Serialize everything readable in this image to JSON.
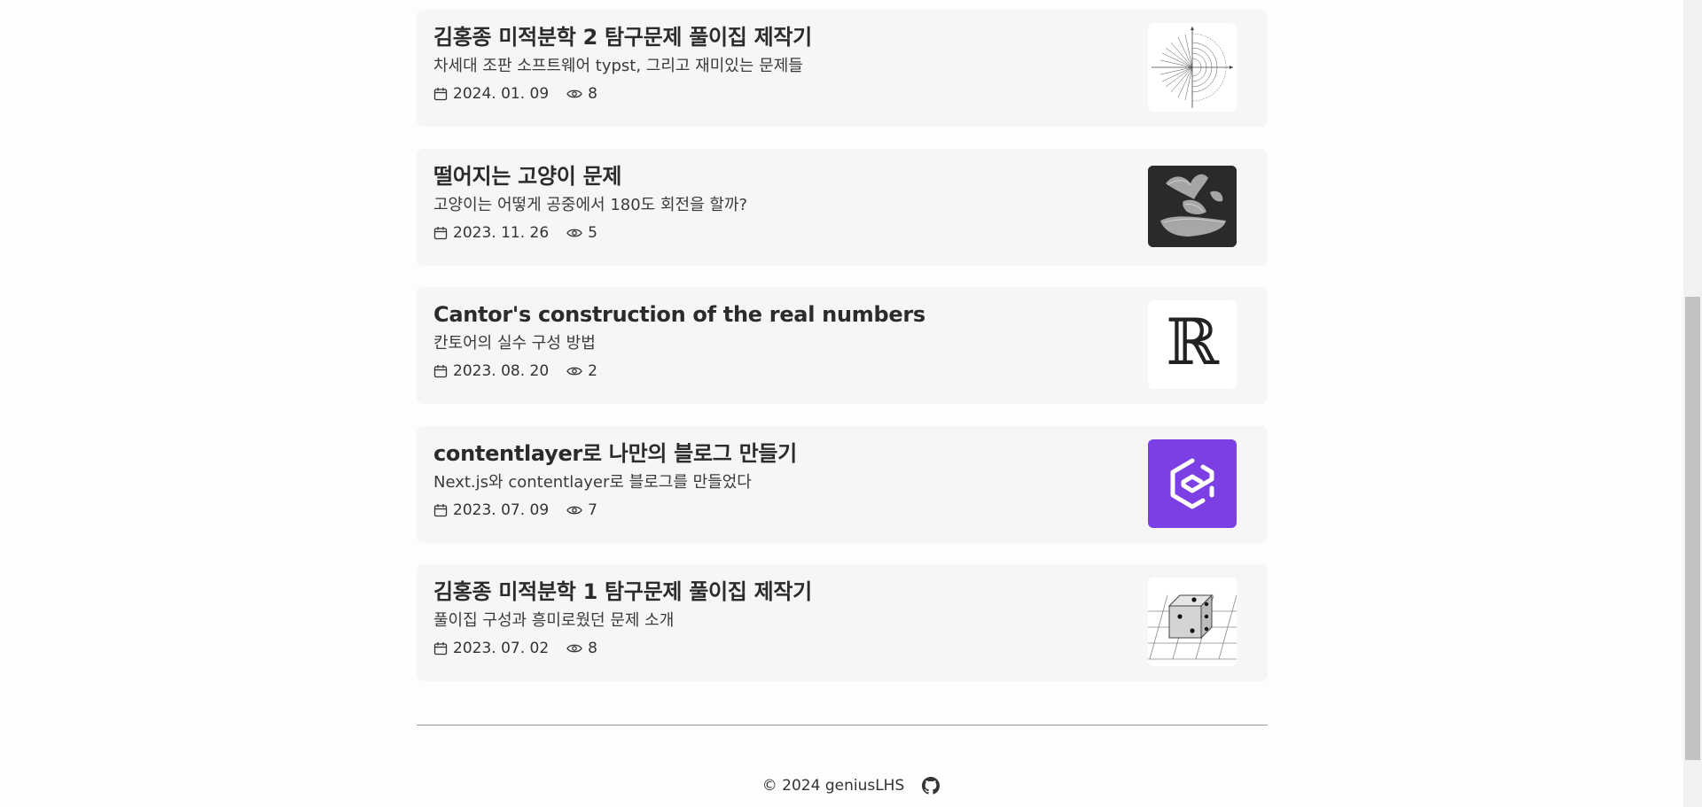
{
  "posts": [
    {
      "title": "김홍종 미적분학 2 탐구문제 풀이집 제작기",
      "subtitle": "차세대 조판 소프트웨어 typst, 그리고 재미있는 문제들",
      "date": "2024. 01. 09",
      "views": "8",
      "thumbnail": "polar-graph"
    },
    {
      "title": "떨어지는 고양이 문제",
      "subtitle": "고양이는 어떻게 공중에서 180도 회전을 할까?",
      "date": "2023. 11. 26",
      "views": "5",
      "thumbnail": "falling-cat-photo"
    },
    {
      "title": "Cantor's construction of the real numbers",
      "subtitle": "칸토어의 실수 구성 방법",
      "date": "2023. 08. 20",
      "views": "2",
      "thumbnail": "blackboard-bold-R",
      "thumbnail_text": "ℝ"
    },
    {
      "title": "contentlayer로 나만의 블로그 만들기",
      "subtitle": "Next.js와 contentlayer로 블로그를 만들었다",
      "date": "2023. 07. 09",
      "views": "7",
      "thumbnail": "contentlayer-logo"
    },
    {
      "title": "김홍종 미적분학 1 탐구문제 풀이집 제작기",
      "subtitle": "풀이집 구성과 흥미로웠던 문제 소개",
      "date": "2023. 07. 02",
      "views": "8",
      "thumbnail": "dice-on-grid"
    }
  ],
  "footer": {
    "copyright": "© 2024 geniusLHS",
    "github_icon": "github-icon"
  },
  "icons": {
    "date": "calendar-icon",
    "views": "eye-icon"
  },
  "colors": {
    "card_bg": "#f6f6f6",
    "contentlayer_purple": "#7b3fe4"
  }
}
